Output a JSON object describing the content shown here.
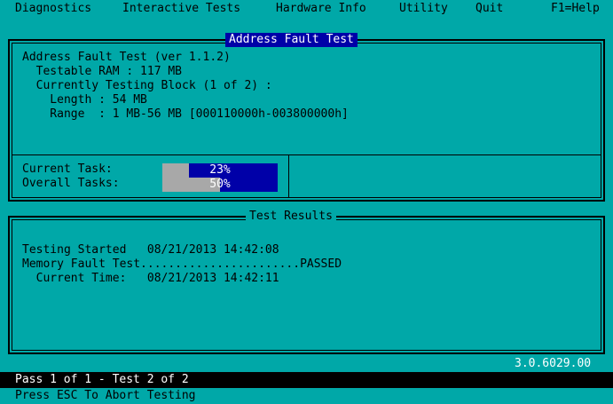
{
  "menu": {
    "items": [
      "Diagnostics",
      "Interactive Tests",
      "Hardware Info",
      "Utility",
      "Quit"
    ],
    "help": "F1=Help"
  },
  "test_panel": {
    "title": "Address Fault Test",
    "lines": [
      "Address Fault Test (ver 1.1.2)",
      "  Testable RAM : 117 MB",
      "  Currently Testing Block (1 of 2) :",
      "    Length : 54 MB",
      "    Range  : 1 MB-56 MB [000110000h-003800000h]"
    ]
  },
  "progress": {
    "current_label": "Current Task:",
    "current_value": 0.23,
    "current_text": "23%",
    "overall_label": "Overall Tasks:",
    "overall_value": 0.5,
    "overall_text": "50%"
  },
  "results": {
    "title": "Test Results",
    "lines": [
      "Testing Started   08/21/2013 14:42:08",
      "Memory Fault Test.......................PASSED",
      "  Current Time:   08/21/2013 14:42:11"
    ]
  },
  "version": "3.0.6029.00",
  "status": {
    "line1": "Pass 1 of 1 - Test 2 of 2",
    "line2": "Press ESC To Abort Testing"
  },
  "colors": {
    "background": "#00a8a8",
    "bar_fill": "#0000a8",
    "bar_track": "#a8a8a8",
    "title_bg": "#0000a8"
  }
}
